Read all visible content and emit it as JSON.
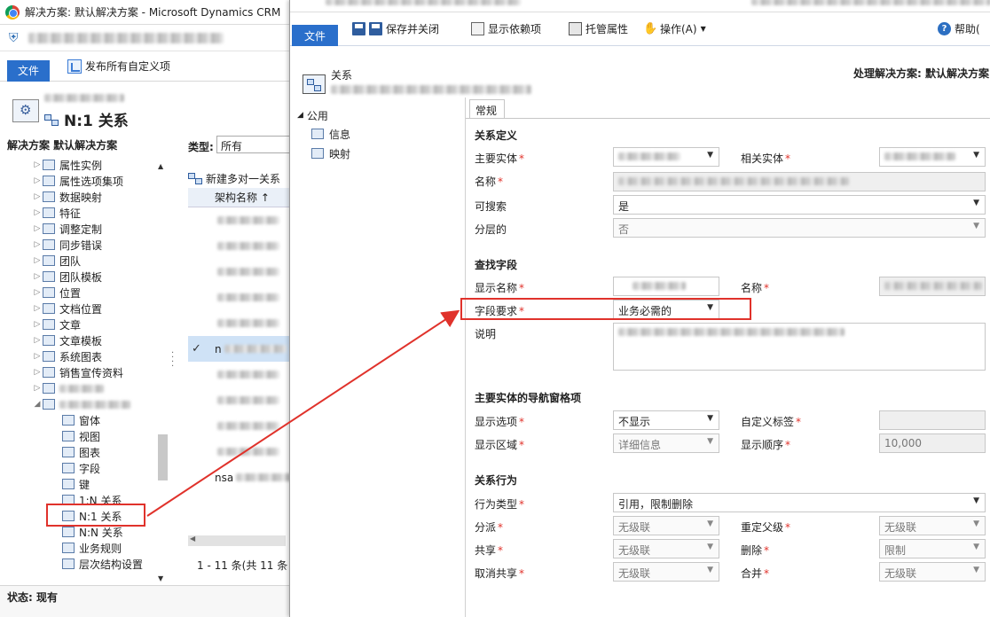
{
  "back": {
    "window_title": "解决方案: 默认解决方案 - Microsoft Dynamics CRM",
    "file_tab": "文件",
    "publish_btn": "发布所有自定义项",
    "entity_title": "N:1 关系",
    "solution_label": "解决方案 默认解决方案",
    "type_label": "类型:",
    "type_value": "所有",
    "tree": [
      {
        "label": "属性实例",
        "level": 1
      },
      {
        "label": "属性选项集项",
        "level": 1
      },
      {
        "label": "数据映射",
        "level": 1
      },
      {
        "label": "特征",
        "level": 1
      },
      {
        "label": "调整定制",
        "level": 1
      },
      {
        "label": "同步错误",
        "level": 1
      },
      {
        "label": "团队",
        "level": 1
      },
      {
        "label": "团队模板",
        "level": 1
      },
      {
        "label": "位置",
        "level": 1
      },
      {
        "label": "文档位置",
        "level": 1
      },
      {
        "label": "文章",
        "level": 1
      },
      {
        "label": "文章模板",
        "level": 1
      },
      {
        "label": "系统图表",
        "level": 1
      },
      {
        "label": "销售宣传资料",
        "level": 1
      },
      {
        "label": "",
        "level": 1
      },
      {
        "label": "",
        "level": 1
      },
      {
        "label": "窗体",
        "level": 2
      },
      {
        "label": "视图",
        "level": 2
      },
      {
        "label": "图表",
        "level": 2
      },
      {
        "label": "字段",
        "level": 2
      },
      {
        "label": "键",
        "level": 2
      },
      {
        "label": "1:N 关系",
        "level": 2
      },
      {
        "label": "N:1 关系",
        "level": 2
      },
      {
        "label": "N:N 关系",
        "level": 2
      },
      {
        "label": "业务规则",
        "level": 2
      },
      {
        "label": "层次结构设置",
        "level": 2
      }
    ],
    "new_rel_btn": "新建多对一关系",
    "col_header": "架构名称 ↑",
    "grid_rows": [
      "",
      "",
      "",
      "",
      "",
      "n",
      "",
      "",
      "",
      "",
      "nsa"
    ],
    "pager": "1 - 11 条(共 11 条",
    "status": "状态: 现有"
  },
  "front": {
    "file_tab": "文件",
    "toolbar": {
      "save_close": "保存并关闭",
      "show_deps": "显示依赖项",
      "managed_props": "托管属性",
      "actions": "操作(A)",
      "help": "帮助("
    },
    "rel_label": "关系",
    "proc_label": "处理解决方案: 默认解决方案",
    "nav": {
      "common": "公用",
      "info": "信息",
      "mapping": "映射"
    },
    "tab_general": "常规",
    "sections": {
      "rel_def": "关系定义",
      "lookup": "查找字段",
      "nav_pane": "主要实体的导航窗格项",
      "behavior": "关系行为"
    },
    "labels": {
      "primary_entity": "主要实体",
      "related_entity": "相关实体",
      "name": "名称",
      "searchable": "可搜索",
      "hierarchical": "分层的",
      "display_name": "显示名称",
      "lookup_name": "名称",
      "field_req": "字段要求",
      "desc": "说明",
      "display_opt": "显示选项",
      "custom_label": "自定义标签",
      "display_area": "显示区域",
      "display_order": "显示顺序",
      "behavior_type": "行为类型",
      "assign": "分派",
      "reparent": "重定父级",
      "share": "共享",
      "delete": "删除",
      "unshare": "取消共享",
      "merge": "合并"
    },
    "values": {
      "searchable": "是",
      "hierarchical": "否",
      "field_req": "业务必需的",
      "display_opt": "不显示",
      "display_area": "详细信息",
      "display_order": "10,000",
      "behavior_type": "引用，限制删除",
      "assign": "无级联",
      "reparent": "无级联",
      "share": "无级联",
      "delete": "限制",
      "unshare": "无级联",
      "merge": "无级联"
    },
    "req_mark": "*"
  },
  "colors": {
    "accent": "#2a6fcb",
    "highlight": "#e0322b",
    "selected_row": "#cfe2f6"
  }
}
